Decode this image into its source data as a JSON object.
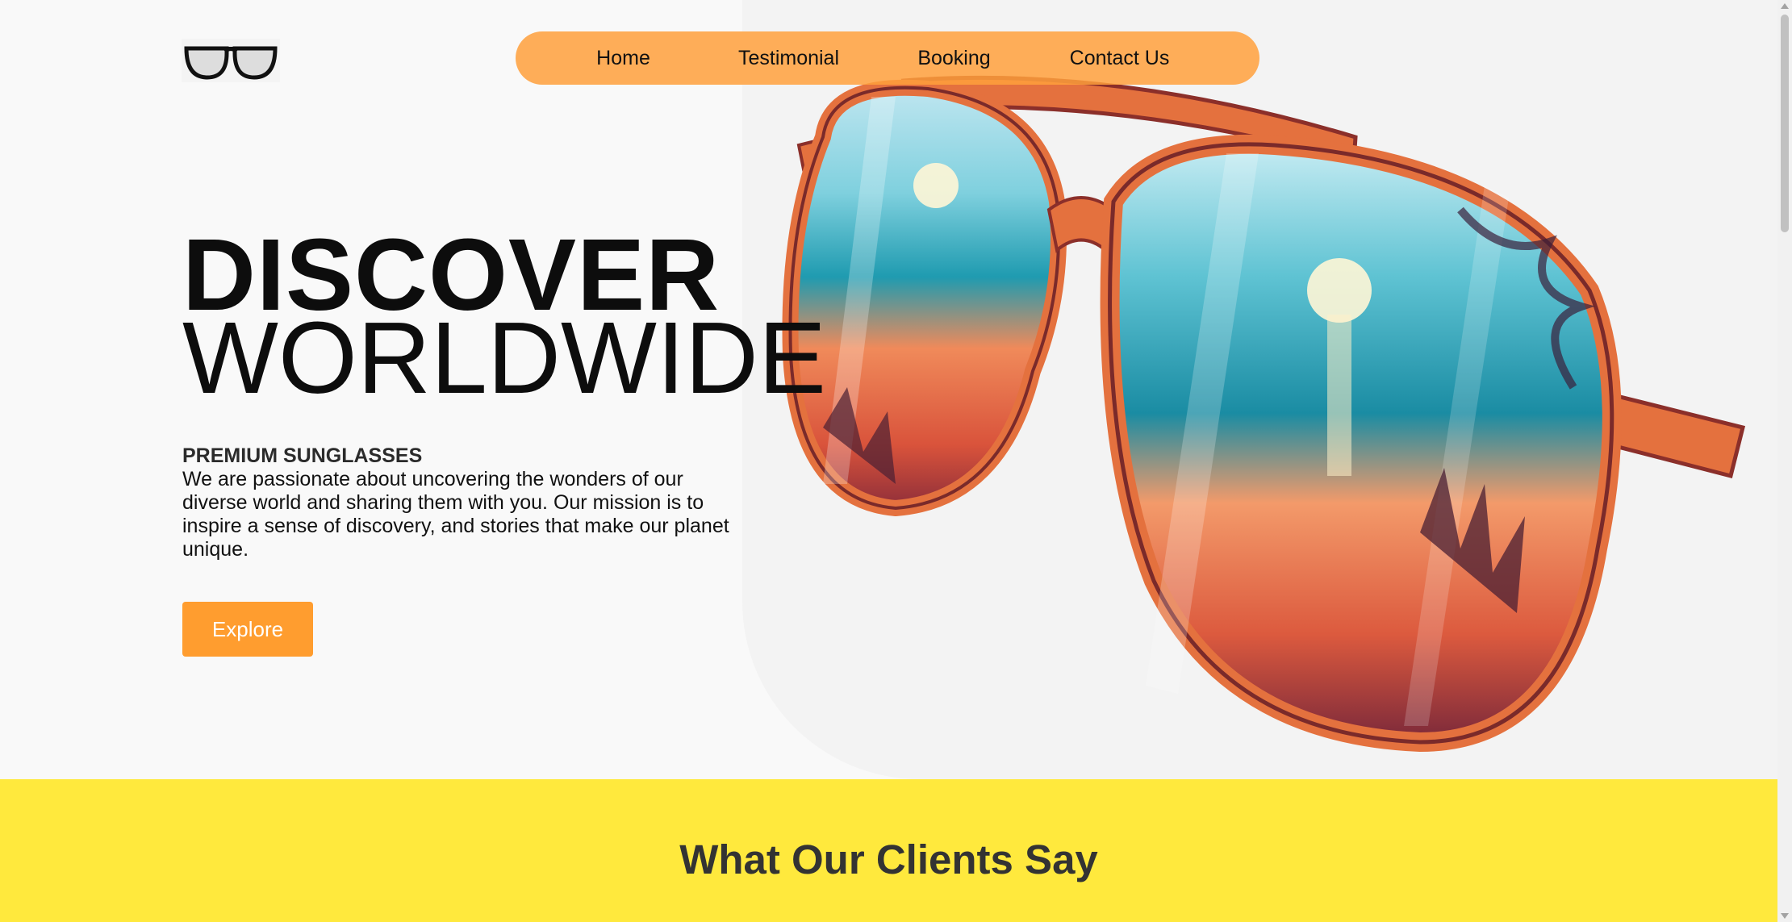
{
  "logo": {
    "icon": "eyeglasses-icon"
  },
  "nav": {
    "items": [
      {
        "label": "Home"
      },
      {
        "label": "Testimonial"
      },
      {
        "label": "Booking"
      },
      {
        "label": "Contact Us"
      }
    ]
  },
  "hero": {
    "title_line_1": "DISCOVER",
    "title_line_2": "WORLDWIDE",
    "subtitle": "PREMIUM SUNGLASSES",
    "description": "We are passionate about uncovering the wonders of our diverse world and sharing them with you. Our mission is to inspire a sense of discovery, and stories that make our planet unique.",
    "cta_label": "Explore",
    "image": "beach-sunglasses-illustration"
  },
  "testimonials": {
    "heading": "What Our Clients Say"
  },
  "colors": {
    "nav_bg": "#ffa03c",
    "cta_bg": "#ff9d2f",
    "testimonial_bg": "#ffe93d",
    "frame": "#e4713e"
  }
}
